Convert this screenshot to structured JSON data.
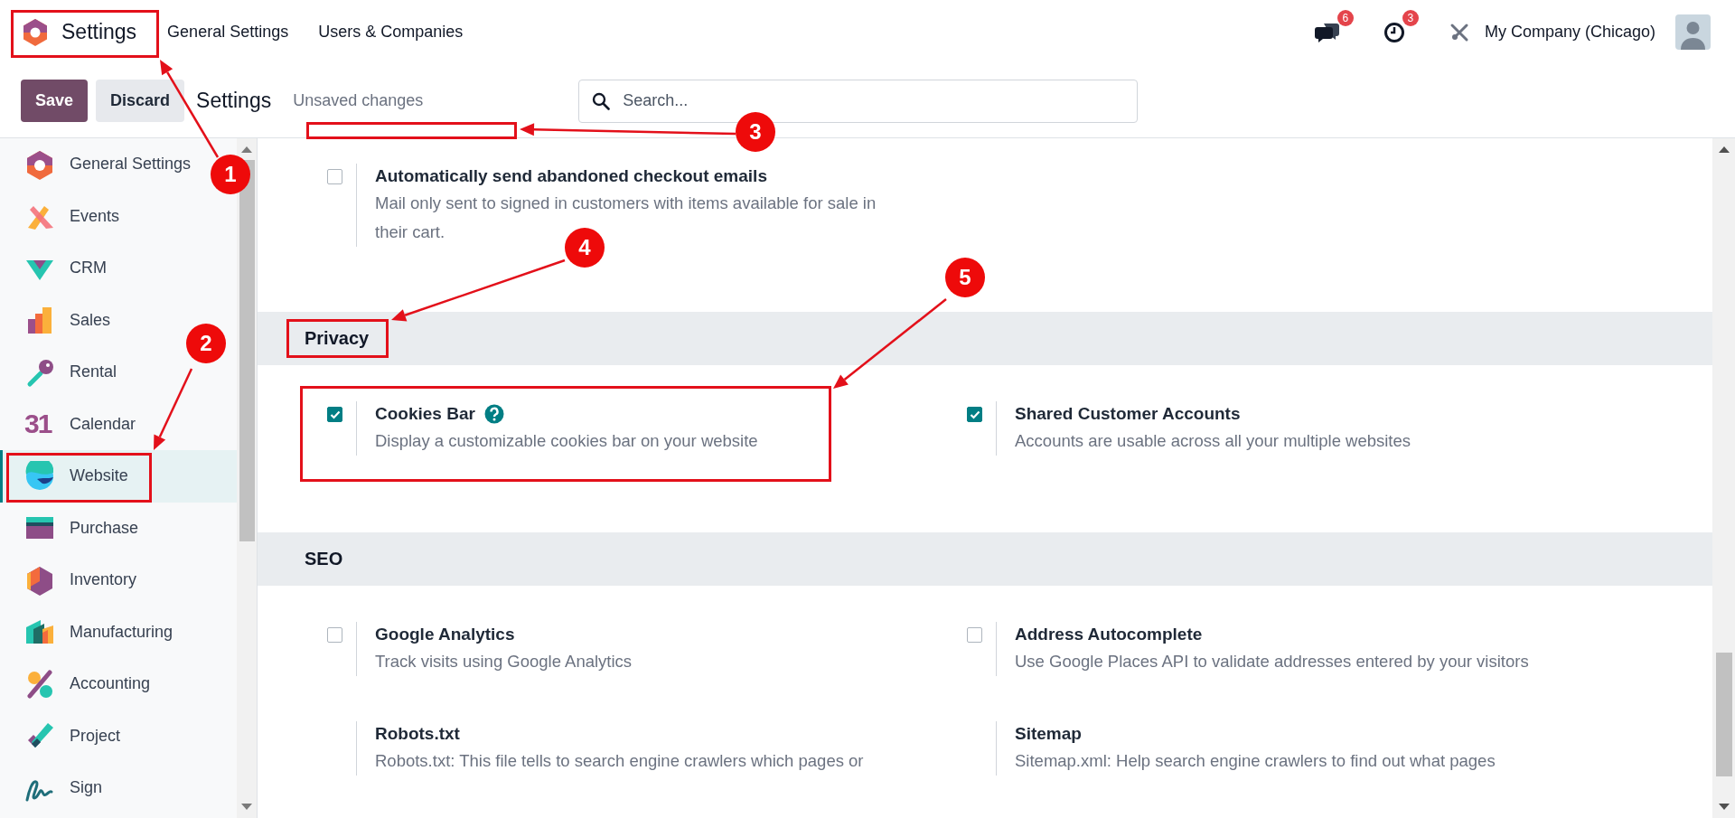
{
  "topbar": {
    "app_name": "Settings",
    "menu": [
      "General Settings",
      "Users & Companies"
    ],
    "messages_badge": "6",
    "activities_badge": "3",
    "company": "My Company (Chicago)"
  },
  "controlbar": {
    "save": "Save",
    "discard": "Discard",
    "breadcrumb": "Settings",
    "status": "Unsaved changes",
    "search": {
      "placeholder": "Search..."
    }
  },
  "sidebar": {
    "items": [
      {
        "label": "General Settings",
        "selected": false
      },
      {
        "label": "Events",
        "selected": false
      },
      {
        "label": "CRM",
        "selected": false
      },
      {
        "label": "Sales",
        "selected": false
      },
      {
        "label": "Rental",
        "selected": false
      },
      {
        "label": "Calendar",
        "selected": false,
        "icon_text": "31"
      },
      {
        "label": "Website",
        "selected": true
      },
      {
        "label": "Purchase",
        "selected": false
      },
      {
        "label": "Inventory",
        "selected": false
      },
      {
        "label": "Manufacturing",
        "selected": false
      },
      {
        "label": "Accounting",
        "selected": false
      },
      {
        "label": "Project",
        "selected": false
      },
      {
        "label": "Sign",
        "selected": false
      }
    ]
  },
  "sections": [
    {
      "settings": [
        {
          "kind": "checkbox",
          "checked": false,
          "title": "Automatically send abandoned checkout emails",
          "description": "Mail only sent to signed in customers with items available for sale in their cart."
        }
      ]
    },
    {
      "title": "Privacy",
      "settings": [
        {
          "kind": "checkbox",
          "checked": true,
          "title": "Cookies Bar",
          "help": true,
          "description": "Display a customizable cookies bar on your website"
        },
        {
          "kind": "checkbox",
          "checked": true,
          "title": "Shared Customer Accounts",
          "description": "Accounts are usable across all your multiple websites"
        }
      ]
    },
    {
      "title": "SEO",
      "settings": [
        {
          "kind": "checkbox",
          "checked": false,
          "title": "Google Analytics",
          "description": "Track visits using Google Analytics"
        },
        {
          "kind": "checkbox",
          "checked": false,
          "title": "Address Autocomplete",
          "description": "Use Google Places API to validate addresses entered by your visitors"
        },
        {
          "kind": "plain",
          "title": "Robots.txt",
          "description": "Robots.txt: This file tells to search engine crawlers which pages or"
        },
        {
          "kind": "plain",
          "title": "Sitemap",
          "description": "Sitemap.xml: Help search engine crawlers to find out what pages"
        }
      ]
    }
  ],
  "annotations": [
    {
      "label": "1"
    },
    {
      "label": "2"
    },
    {
      "label": "3"
    },
    {
      "label": "4"
    },
    {
      "label": "5"
    }
  ]
}
